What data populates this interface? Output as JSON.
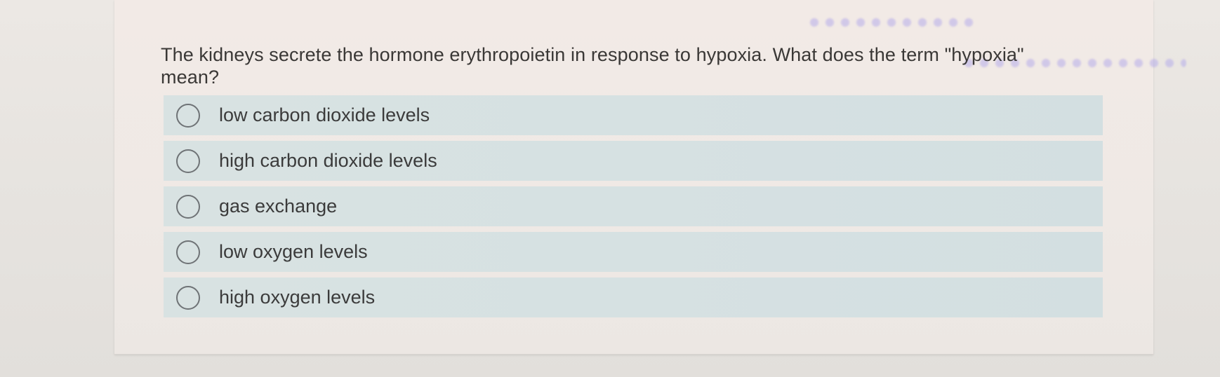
{
  "question": {
    "text": "The kidneys secrete the hormone erythropoietin in response to hypoxia. What does the term \"hypoxia\" mean?"
  },
  "options": [
    {
      "label": "low carbon dioxide levels"
    },
    {
      "label": "high carbon dioxide levels"
    },
    {
      "label": "gas exchange"
    },
    {
      "label": "low oxygen levels"
    },
    {
      "label": "high oxygen levels"
    }
  ],
  "colors": {
    "card_background": "#efe9e5",
    "option_background": "#d6e1e2",
    "radio_border": "#6f7376",
    "text": "#3a3836"
  },
  "icons": {
    "option_radio": "radio-unchecked-icon"
  }
}
